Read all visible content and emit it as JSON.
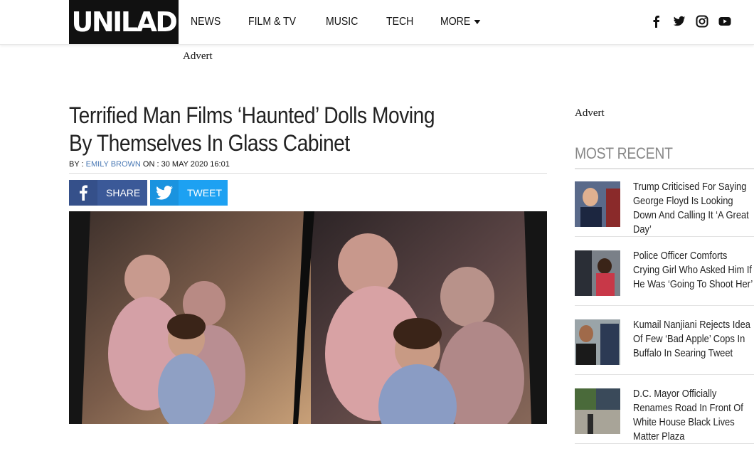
{
  "header": {
    "logo": "UNILAD",
    "nav": [
      "NEWS",
      "FILM & TV",
      "MUSIC",
      "TECH",
      "MORE"
    ],
    "social_icons": [
      "facebook-icon",
      "twitter-icon",
      "instagram-icon",
      "youtube-icon"
    ]
  },
  "advert_top": "Advert",
  "article": {
    "title": "Terrified Man Films ‘Haunted’ Dolls Moving By Themselves In Glass Cabinet",
    "by_prefix": "BY : ",
    "author": "EMILY BROWN",
    "on_prefix": " ON : ",
    "date": "30 MAY 2020 16:01",
    "share_facebook": "SHARE",
    "share_twitter": "TWEET"
  },
  "sidebar": {
    "advert": "Advert",
    "most_recent_title": "MOST RECENT",
    "items": [
      {
        "headline": "Trump Criticised For Saying George Floyd Is Looking Down And Calling It ‘A Great Day’"
      },
      {
        "headline": "Police Officer Comforts Crying Girl Who Asked Him If He Was ‘Going To Shoot Her’"
      },
      {
        "headline": "Kumail Nanjiani Rejects Idea Of Few ‘Bad Apple’ Cops In Buffalo In Searing Tweet"
      },
      {
        "headline": "D.C. Mayor Officially Renames Road In Front Of White House Black Lives Matter Plaza"
      }
    ]
  },
  "colors": {
    "facebook": "#3b5998",
    "twitter": "#1da1f2",
    "author_link": "#4a79b5",
    "most_recent": "#888888"
  }
}
